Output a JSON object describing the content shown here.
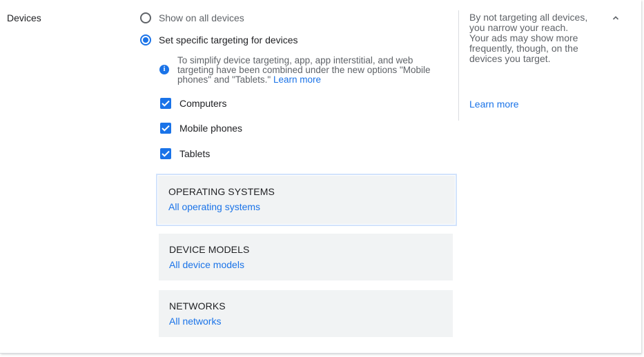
{
  "section": {
    "title": "Devices",
    "collapse_icon": "chevron-up-icon"
  },
  "targeting": {
    "options": [
      {
        "label": "Show on all devices",
        "selected": false
      },
      {
        "label": "Set specific targeting for devices",
        "selected": true
      }
    ]
  },
  "info": {
    "icon": "info-icon",
    "text": "To simplify device targeting, app, app interstitial, and web targeting have been combined under the new options \"Mobile phones\" and \"Tablets.\"",
    "link": "Learn more"
  },
  "devices": [
    {
      "label": "Computers",
      "checked": true
    },
    {
      "label": "Mobile phones",
      "checked": true
    },
    {
      "label": "Tablets",
      "checked": true
    }
  ],
  "panels": [
    {
      "title": "OPERATING SYSTEMS",
      "value": "All operating systems"
    },
    {
      "title": "DEVICE MODELS",
      "value": "All device models"
    },
    {
      "title": "NETWORKS",
      "value": "All networks"
    }
  ],
  "help": {
    "text": "By not targeting all devices, you narrow your reach. Your ads may show more frequently, though, on the devices you target.",
    "link": "Learn more"
  },
  "colors": {
    "accent": "#1a73e8",
    "panel_bg": "#f1f3f4",
    "secondary_text": "#5f6368"
  }
}
